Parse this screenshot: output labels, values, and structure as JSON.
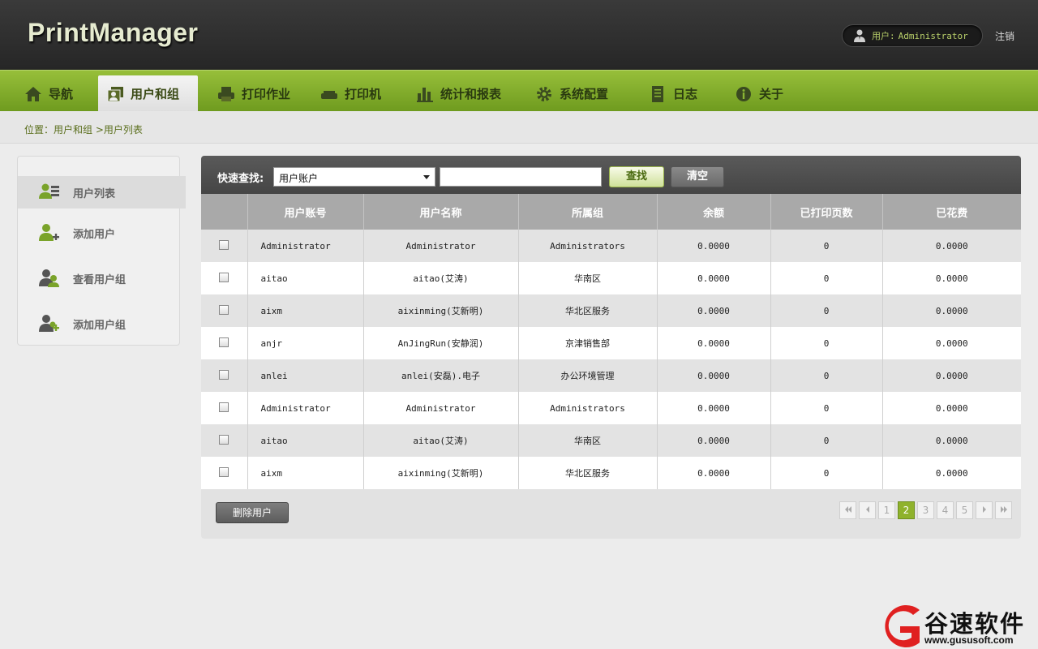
{
  "header": {
    "app_title": "PrintManager",
    "user_label": "用户:",
    "user_name": "Administrator",
    "logout": "注销"
  },
  "nav": {
    "items": [
      {
        "label": "导航",
        "icon": "home-icon"
      },
      {
        "label": "用户和组",
        "icon": "users-groups-icon",
        "active": true
      },
      {
        "label": "打印作业",
        "icon": "print-job-icon"
      },
      {
        "label": "打印机",
        "icon": "printer-icon"
      },
      {
        "label": "统计和报表",
        "icon": "bar-chart-icon"
      },
      {
        "label": "系统配置",
        "icon": "gear-icon"
      },
      {
        "label": "日志",
        "icon": "log-icon"
      },
      {
        "label": "关于",
        "icon": "info-icon"
      }
    ]
  },
  "breadcrumb": "位置：用户和组 >用户列表",
  "sidebar": {
    "items": [
      {
        "label": "用户列表",
        "icon": "user-list-icon",
        "active": true
      },
      {
        "label": "添加用户",
        "icon": "add-user-icon"
      },
      {
        "label": "查看用户组",
        "icon": "view-group-icon"
      },
      {
        "label": "添加用户组",
        "icon": "add-group-icon"
      }
    ]
  },
  "toolbar": {
    "quick_search_label": "快速查找:",
    "select_value": "用户账户",
    "search_input_value": "",
    "search_button": "查找",
    "clear_button": "清空"
  },
  "table": {
    "columns": [
      "用户账号",
      "用户名称",
      "所属组",
      "余额",
      "已打印页数",
      "已花费"
    ],
    "rows": [
      [
        "Administrator",
        "Administrator",
        "Administrators",
        "0.0000",
        "0",
        "0.0000"
      ],
      [
        "aitao",
        "aitao(艾涛)",
        "华南区",
        "0.0000",
        "0",
        "0.0000"
      ],
      [
        "aixm",
        "aixinming(艾新明)",
        "华北区服务",
        "0.0000",
        "0",
        "0.0000"
      ],
      [
        "anjr",
        "AnJingRun(安静润)",
        "京津销售部",
        "0.0000",
        "0",
        "0.0000"
      ],
      [
        "anlei",
        "anlei(安磊).电子",
        "办公环境管理",
        "0.0000",
        "0",
        "0.0000"
      ],
      [
        "Administrator",
        "Administrator",
        "Administrators",
        "0.0000",
        "0",
        "0.0000"
      ],
      [
        "aitao",
        "aitao(艾涛)",
        "华南区",
        "0.0000",
        "0",
        "0.0000"
      ],
      [
        "aixm",
        "aixinming(艾新明)",
        "华北区服务",
        "0.0000",
        "0",
        "0.0000"
      ]
    ]
  },
  "delete_button": "删除用户",
  "pager": {
    "pages": [
      "1",
      "2",
      "3",
      "4",
      "5"
    ],
    "current": "2"
  },
  "watermark": {
    "name": "谷速软件",
    "url": "www.gususoft.com"
  },
  "colors": {
    "nav_green": "#8ab534",
    "accent_green": "#8fb22c",
    "header_dark": "#2e2e2e"
  }
}
